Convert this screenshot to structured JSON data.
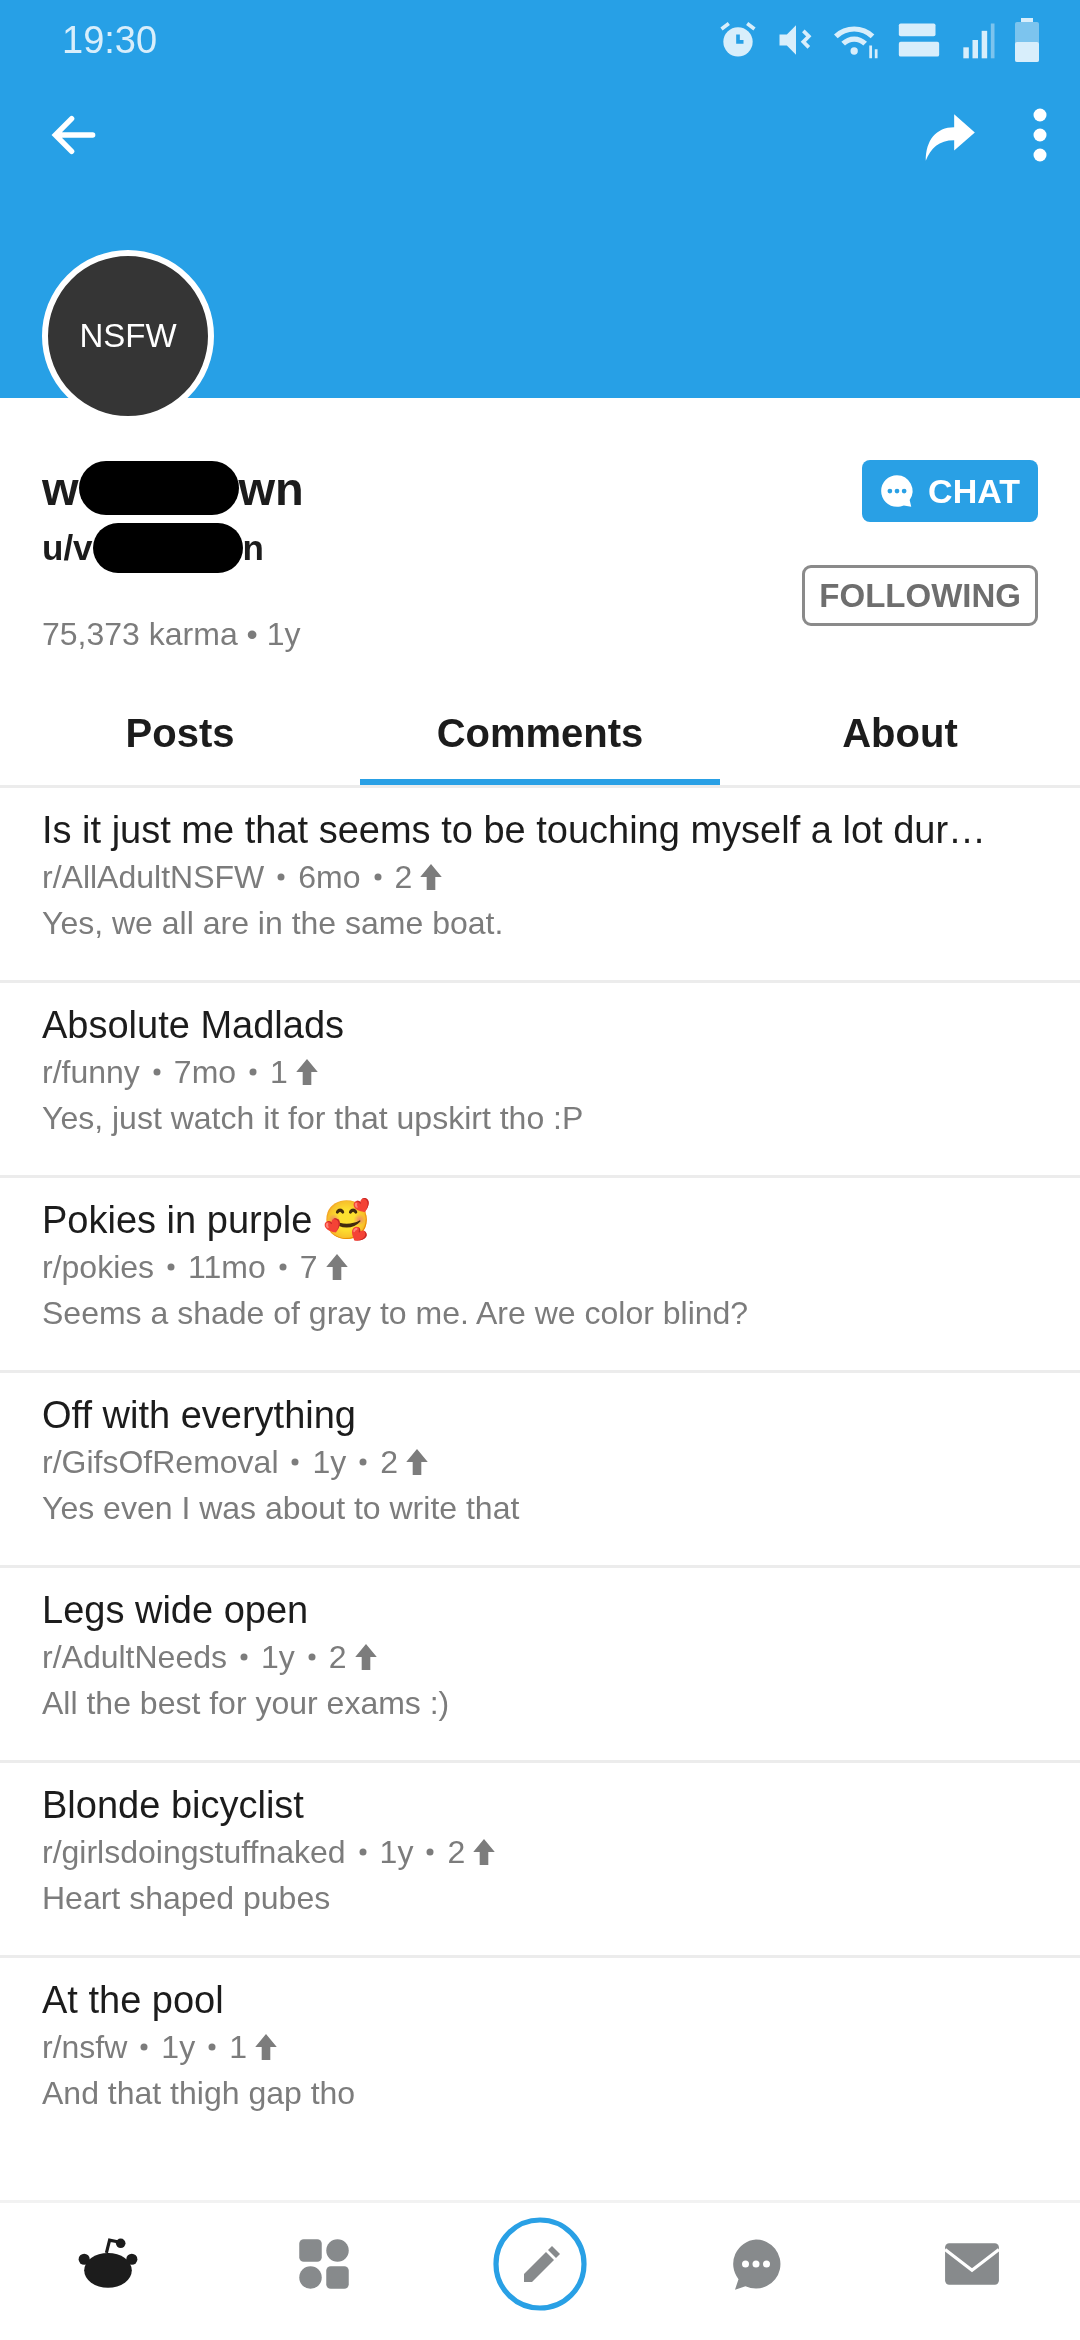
{
  "status_bar": {
    "time": "19:30"
  },
  "profile": {
    "avatar_label": "NSFW",
    "display_name_parts": [
      "w",
      "wn"
    ],
    "username_parts": [
      "u/v",
      "n"
    ],
    "stats": "75,373 karma • 1y",
    "chat_button": "CHAT",
    "follow_button": "FOLLOWING"
  },
  "tabs": [
    {
      "label": "Posts",
      "selected": false
    },
    {
      "label": "Comments",
      "selected": true
    },
    {
      "label": "About",
      "selected": false
    }
  ],
  "comments": [
    {
      "title": "Is it just me that seems to be touching myself a lot dur…",
      "subreddit": "r/AllAdultNSFW",
      "age": "6mo",
      "score": "2",
      "body": "Yes, we all are in the same boat."
    },
    {
      "title": "Absolute Madlads",
      "subreddit": "r/funny",
      "age": "7mo",
      "score": "1",
      "body": "Yes, just watch it for that upskirt tho :P"
    },
    {
      "title": "Pokies in purple 🥰",
      "subreddit": "r/pokies",
      "age": "11mo",
      "score": "7",
      "body": "Seems a shade of gray to me. Are we color blind?"
    },
    {
      "title": "Off with everything",
      "subreddit": "r/GifsOfRemoval",
      "age": "1y",
      "score": "2",
      "body": "Yes even I was about to write that"
    },
    {
      "title": "Legs wide open",
      "subreddit": "r/AdultNeeds",
      "age": "1y",
      "score": "2",
      "body": "All the best for your exams :)"
    },
    {
      "title": "Blonde bicyclist",
      "subreddit": "r/girlsdoingstuffnaked",
      "age": "1y",
      "score": "2",
      "body": "Heart shaped pubes"
    },
    {
      "title": "At the pool",
      "subreddit": "r/nsfw",
      "age": "1y",
      "score": "1",
      "body": "And that thigh gap tho"
    }
  ],
  "bottom_nav": [
    {
      "kind": "home",
      "selected": true
    },
    {
      "kind": "communities",
      "selected": false
    },
    {
      "kind": "post",
      "selected": false
    },
    {
      "kind": "chat",
      "selected": false
    },
    {
      "kind": "inbox",
      "selected": false
    }
  ]
}
